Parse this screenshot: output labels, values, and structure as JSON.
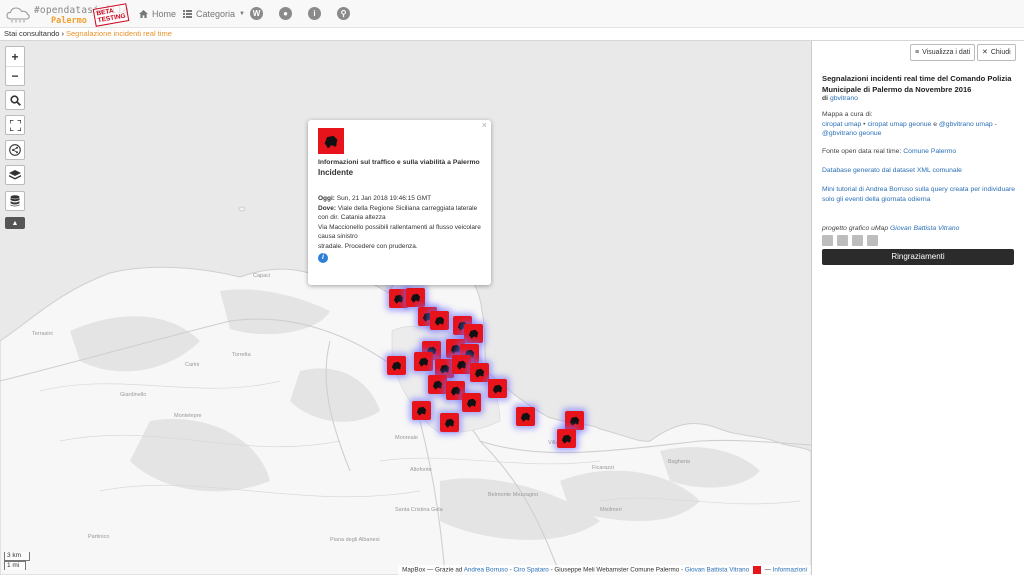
{
  "navbar": {
    "brand": "#opendatasicilia",
    "city": "Palermo",
    "beta": "BETA TESTING",
    "home": "Home",
    "categoria": "Categoria"
  },
  "breadcrumb": {
    "prefix": "Stai consultando",
    "current": "Segnalazione incidenti real time"
  },
  "popup": {
    "title": "Informazioni sul traffico e sulla viabilità a Palermo",
    "subtitle": "Incidente",
    "date_label": "Oggi:",
    "date_value": "Sun, 21 Jan 2018 19:46:15 GMT",
    "where_label": "Dove:",
    "where_value": "Viale della Regione Siciliana carreggiata laterale con dir. Catania altezza",
    "line2": "Via Maccionello possibili rallentamenti al flusso veicolare causa sinistro",
    "line3": "stradale. Procedere con prudenza."
  },
  "map": {
    "scale_km": "3 km",
    "scale_mi": "1 mi",
    "attribution_prefix": "MapBox — Grazie ad",
    "attr_andrea": "Andrea Borruso",
    "attr_ciro": "Ciro Spataro",
    "attr_mid": "- Giuseppe Meli Webamster Comune Palermo -",
    "attr_giovan": "Giovan Battista Vitrano",
    "attr_info": "Informazioni",
    "labels": [
      {
        "text": "Capaci"
      },
      {
        "text": "Terrasini"
      },
      {
        "text": "Carini"
      },
      {
        "text": "Torretta"
      },
      {
        "text": "Montelepre"
      },
      {
        "text": "Giardinello"
      },
      {
        "text": "Partinico"
      },
      {
        "text": "Belmonte Mezzagno"
      },
      {
        "text": "Villabate"
      },
      {
        "text": "Bagheria"
      },
      {
        "text": "Misilmeri"
      },
      {
        "text": "Ficarazzi"
      },
      {
        "text": "Piana degli Albanesi"
      },
      {
        "text": "Altofonte"
      },
      {
        "text": "Monreale"
      },
      {
        "text": "Santa Cristina Gela"
      }
    ]
  },
  "panel": {
    "btn_view_data": "Visualizza i dati",
    "btn_close": "Chiudi",
    "title": "Segnalazioni incidenti real time del Comando Polizia Municipale di Palermo da Novembre 2016",
    "by_prefix": "di",
    "by_user": "gbvitrano",
    "map_by_label": "Mappa a cura di:",
    "map_by_1": "ciropat umap",
    "map_by_2": "ciropat umap geonue",
    "map_by_and": "e",
    "map_by_3": "@gbvitrano umap",
    "map_by_4": "@gbvitrano geonue",
    "source_label": "Fonte open data real time:",
    "source_link": "Comune Palermo",
    "database": "Database generato dal dataset XML comunale",
    "tutorial": "Mini tutorial di Andrea Borruso sulla query creata per individuare solo gli eventi della giornata odierna",
    "graphic_label": "progetto grafico uMap",
    "graphic_author": "Giovan Battista Vitrano",
    "thanks": "Ringraziamenti"
  }
}
